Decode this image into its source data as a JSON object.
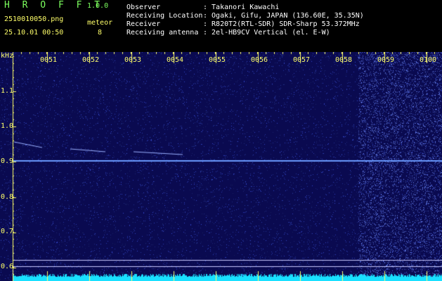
{
  "header": {
    "app_name": "H R O F F T",
    "version": "1.0.0",
    "filename": "2510010050.png",
    "datetime": "25.10.01 00:50",
    "meteor_label": "meteor",
    "meteor_count": "8",
    "info_labels": [
      "Observer",
      "Receiving Location",
      "Receiver",
      "Receiving antenna"
    ],
    "info_values": [
      ": Takanori Kawachi",
      ": Ogaki, Gifu, JAPAN (136.60E, 35.35N)",
      ": R820T2(RTL-SDR) SDR-Sharp 53.372MHz",
      ": 2el-HB9CV Vertical (el. E-W)"
    ]
  },
  "spectrogram": {
    "y_unit": "kHz",
    "y_ticks": [
      "1.1",
      "1.0",
      "0.9",
      "0.8",
      "0.7",
      "0.6"
    ],
    "x_ticks": [
      "0051",
      "0052",
      "0053",
      "0054",
      "0055",
      "0056",
      "0057",
      "0058",
      "0059",
      "0100"
    ],
    "colors": {
      "background": "#0a0a50",
      "noise": "#3040c0",
      "carrier": "#6a9aff",
      "meteor": "#9ab0ff",
      "bottom_band": "#19e0ff",
      "grid": "#ffff6a",
      "marker_lines": "#c8c8ff"
    }
  }
}
